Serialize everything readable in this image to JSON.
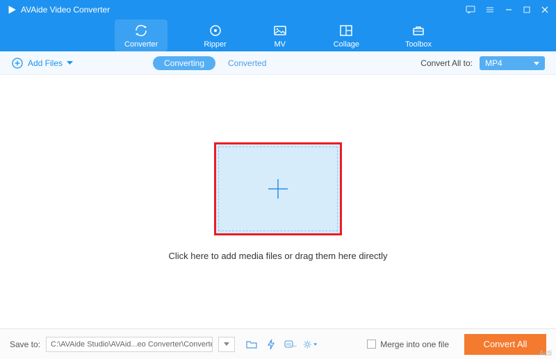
{
  "app": {
    "title": "AVAide Video Converter"
  },
  "nav": {
    "items": [
      {
        "label": "Converter",
        "active": true
      },
      {
        "label": "Ripper"
      },
      {
        "label": "MV"
      },
      {
        "label": "Collage"
      },
      {
        "label": "Toolbox"
      }
    ]
  },
  "subbar": {
    "add_files": "Add Files",
    "tabs": {
      "converting": "Converting",
      "converted": "Converted"
    },
    "convert_all_to_label": "Convert All to:",
    "format": "MP4"
  },
  "main": {
    "drop_text": "Click here to add media files or drag them here directly"
  },
  "footer": {
    "save_to_label": "Save to:",
    "save_path": "C:\\AVAide Studio\\AVAid...eo Converter\\Converted",
    "merge_label": "Merge into one file",
    "convert_all": "Convert All"
  },
  "watermark": "Acti"
}
